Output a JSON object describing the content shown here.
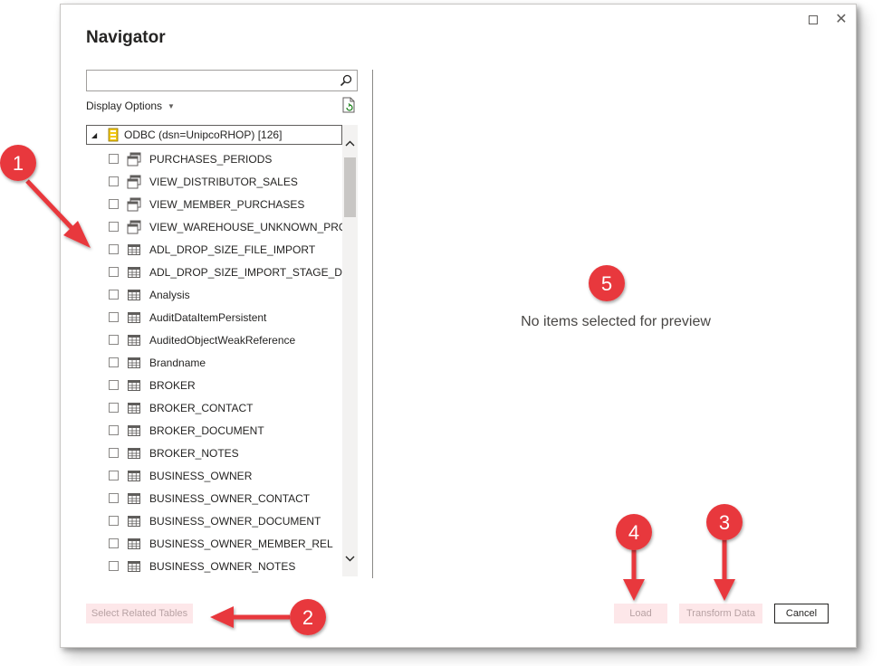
{
  "window": {
    "title": "Navigator",
    "maximize_label": "Maximize",
    "close_glyph": "✕"
  },
  "search": {
    "value": "",
    "placeholder": ""
  },
  "display_options": {
    "label": "Display Options",
    "caret": "▼"
  },
  "tree": {
    "root_label": "ODBC (dsn=UnipcoRHOP) [126]",
    "items": [
      {
        "label": "PURCHASES_PERIODS",
        "icon": "view-icon"
      },
      {
        "label": "VIEW_DISTRIBUTOR_SALES",
        "icon": "view-icon"
      },
      {
        "label": "VIEW_MEMBER_PURCHASES",
        "icon": "view-icon"
      },
      {
        "label": "VIEW_WAREHOUSE_UNKNOWN_PRO...",
        "icon": "view-icon"
      },
      {
        "label": "ADL_DROP_SIZE_FILE_IMPORT",
        "icon": "table-icon"
      },
      {
        "label": "ADL_DROP_SIZE_IMPORT_STAGE_DATA",
        "icon": "table-icon"
      },
      {
        "label": "Analysis",
        "icon": "table-icon"
      },
      {
        "label": "AuditDataItemPersistent",
        "icon": "table-icon"
      },
      {
        "label": "AuditedObjectWeakReference",
        "icon": "table-icon"
      },
      {
        "label": "Brandname",
        "icon": "table-icon"
      },
      {
        "label": "BROKER",
        "icon": "table-icon"
      },
      {
        "label": "BROKER_CONTACT",
        "icon": "table-icon"
      },
      {
        "label": "BROKER_DOCUMENT",
        "icon": "table-icon"
      },
      {
        "label": "BROKER_NOTES",
        "icon": "table-icon"
      },
      {
        "label": "BUSINESS_OWNER",
        "icon": "table-icon"
      },
      {
        "label": "BUSINESS_OWNER_CONTACT",
        "icon": "table-icon"
      },
      {
        "label": "BUSINESS_OWNER_DOCUMENT",
        "icon": "table-icon"
      },
      {
        "label": "BUSINESS_OWNER_MEMBER_REL",
        "icon": "table-icon"
      },
      {
        "label": "BUSINESS_OWNER_NOTES",
        "icon": "table-icon"
      }
    ]
  },
  "preview": {
    "message": "No items selected for preview"
  },
  "buttons": {
    "select_related": "Select Related Tables",
    "load": "Load",
    "transform": "Transform Data",
    "cancel": "Cancel"
  },
  "annotations": [
    "1",
    "2",
    "3",
    "4",
    "5"
  ],
  "colors": {
    "annotation_red": "#e8373c",
    "disabled_button_bg": "#fde7e9"
  }
}
